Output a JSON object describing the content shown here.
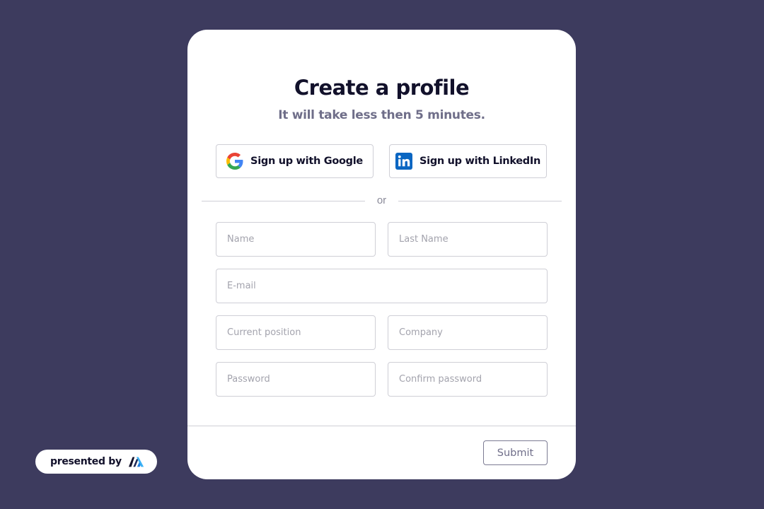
{
  "form": {
    "title": "Create a profile",
    "subtitle": "It will take less then 5 minutes.",
    "social": {
      "google_label": "Sign up with Google",
      "google_icon": "google-icon",
      "linkedin_label": "Sign up with LinkedIn",
      "linkedin_icon": "linkedin-icon",
      "linkedin_color": "#0a66c2"
    },
    "divider_text": "or",
    "fields": {
      "name_placeholder": "Name",
      "last_name_placeholder": "Last Name",
      "email_placeholder": "E-mail",
      "position_placeholder": "Current position",
      "company_placeholder": "Company",
      "password_placeholder": "Password",
      "confirm_password_placeholder": "Confirm password"
    },
    "submit_label": "Submit"
  },
  "badge": {
    "text": "presented by",
    "logo_icon": "brand-logo-icon"
  },
  "colors": {
    "background": "#3d3b5e",
    "card": "#ffffff",
    "title": "#12112b",
    "subtitle": "#6f6e89"
  }
}
